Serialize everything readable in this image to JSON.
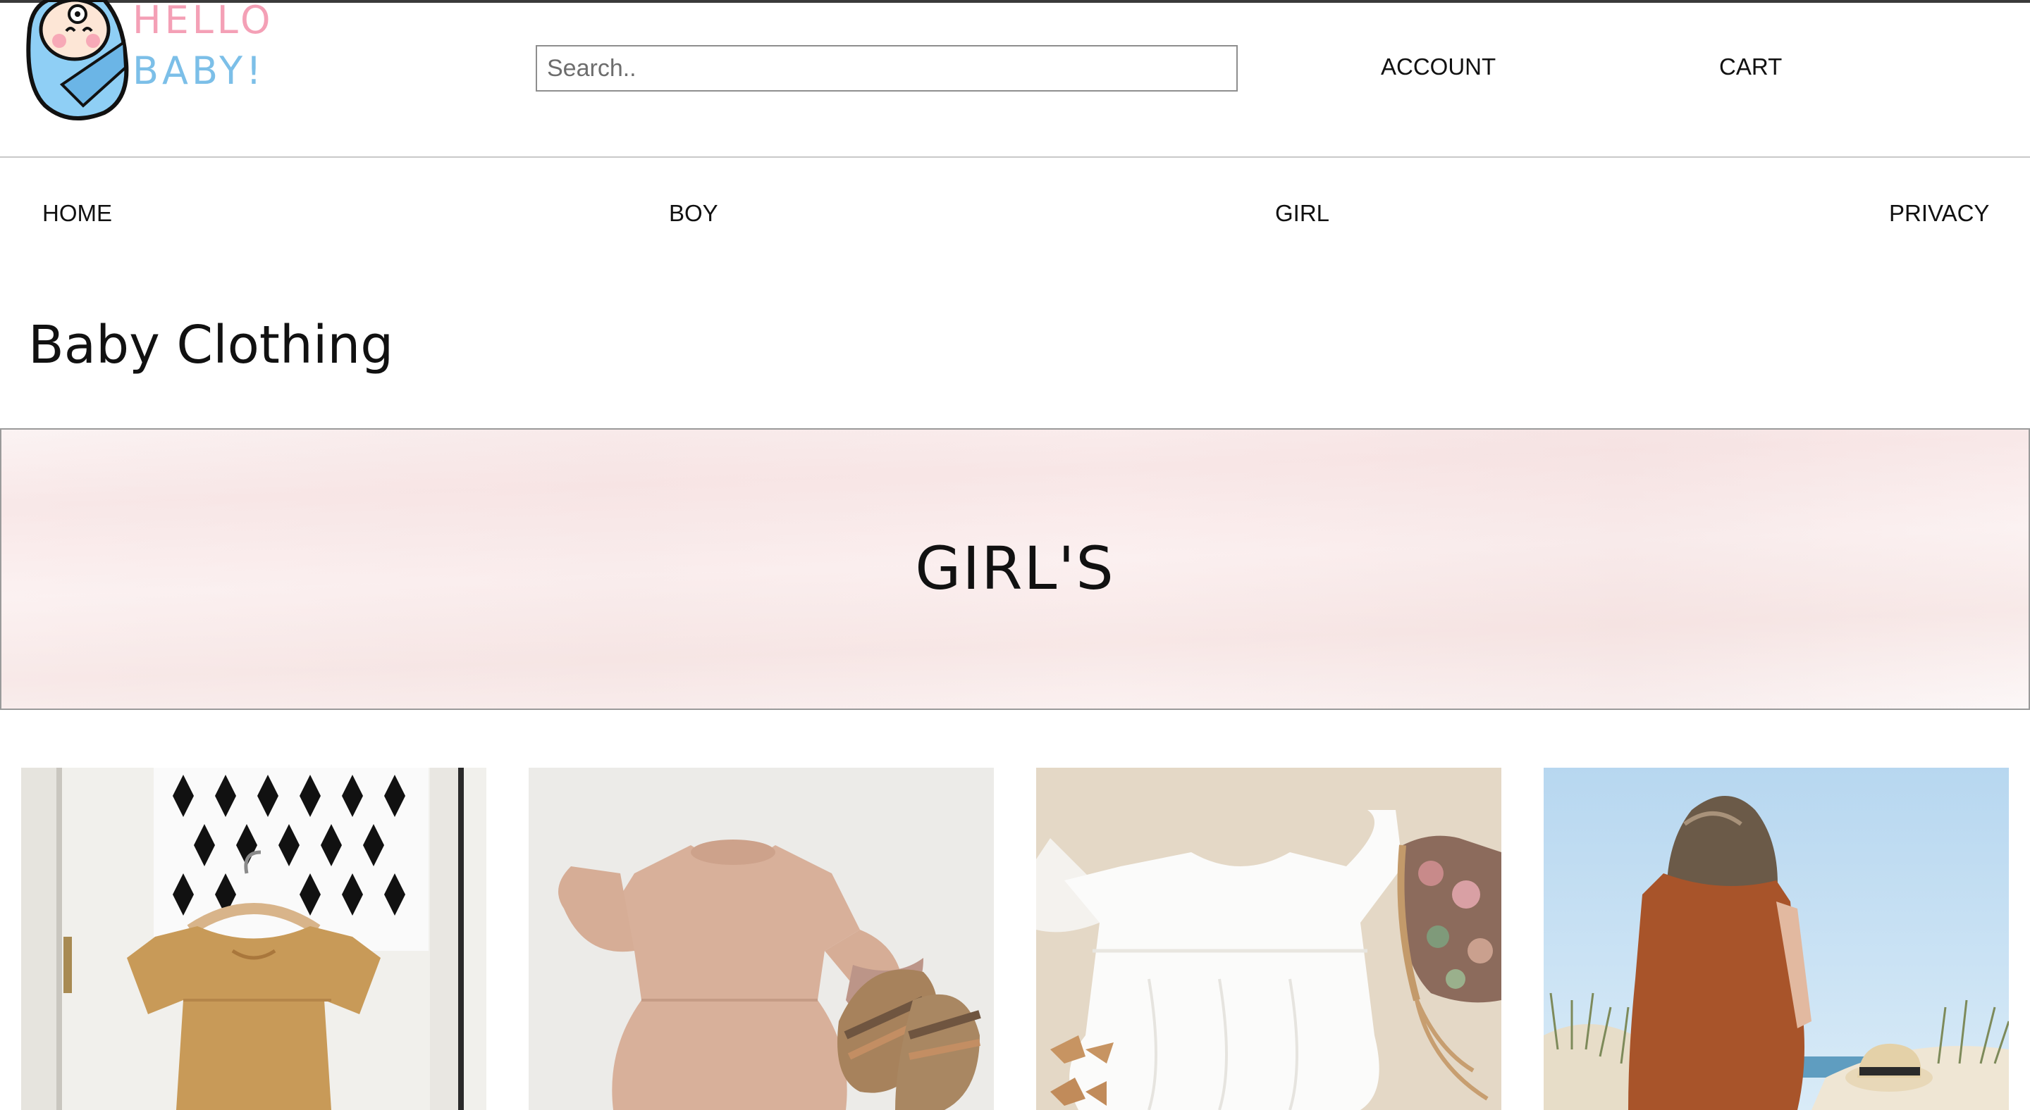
{
  "logo": {
    "line1": "HELLO",
    "line2": "BABY!"
  },
  "search": {
    "placeholder": "Search.."
  },
  "header": {
    "account": "ACCOUNT",
    "cart": "CART"
  },
  "nav": {
    "home": "HOME",
    "boy": "BOY",
    "girl": "GIRL",
    "privacy": "PRIVACY"
  },
  "page": {
    "title": "Baby Clothing"
  },
  "banner": {
    "title": "GIRL'S"
  },
  "products": [
    {
      "image": "mustard-linen-dress-on-hanger"
    },
    {
      "image": "pink-linen-dress-with-sandals"
    },
    {
      "image": "white-flutter-dress-with-floral-bonnet"
    },
    {
      "image": "woman-in-rust-dress-at-beach"
    }
  ]
}
